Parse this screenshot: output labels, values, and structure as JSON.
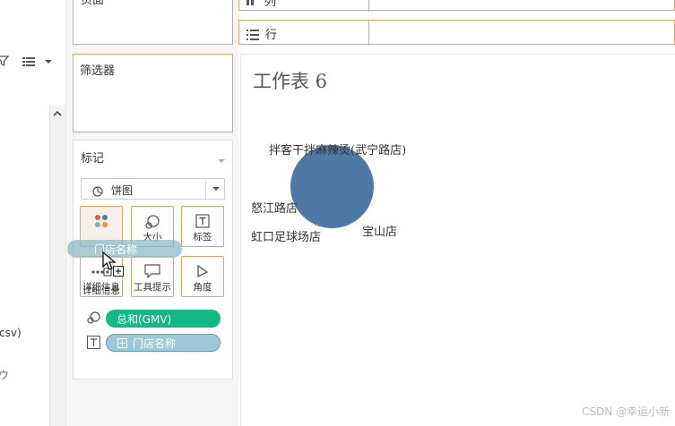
{
  "left_pane": {
    "filter_icon": "filter-icon",
    "view_icon": "grid-icon",
    "file_label": "csv)",
    "partial_item": "ウ"
  },
  "shelves": {
    "pages_label": "页面",
    "filters_label": "筛选器",
    "columns_label": "列",
    "rows_label": "行"
  },
  "marks": {
    "title": "标记",
    "mark_type": "饼图",
    "buttons": [
      {
        "label": "详细信息",
        "icon": "detail-dots-icon"
      },
      {
        "label": "大小",
        "icon": "size-icon"
      },
      {
        "label": "标签",
        "icon": "label-T-icon"
      },
      {
        "label": "详细信息",
        "icon": "detail-icon"
      },
      {
        "label": "工具提示",
        "icon": "tooltip-icon"
      },
      {
        "label": "角度",
        "icon": "angle-icon"
      }
    ],
    "drag_pill": "门店名称",
    "fields": [
      {
        "label": "总和(GMV)",
        "type": "size",
        "color": "#12b886"
      },
      {
        "label": "门店名称",
        "type": "label",
        "color": "#9cc8d8"
      }
    ]
  },
  "sheet": {
    "title": "工作表 6",
    "labels": {
      "store_a": "拌客干拌麻辣烫(武宁路店)",
      "store_b": "怒江路店",
      "store_c": "虹口足球场店",
      "store_d": "宝山店"
    },
    "pie_color": "#4e79a7"
  },
  "watermark": "CSDN @幸运小新"
}
